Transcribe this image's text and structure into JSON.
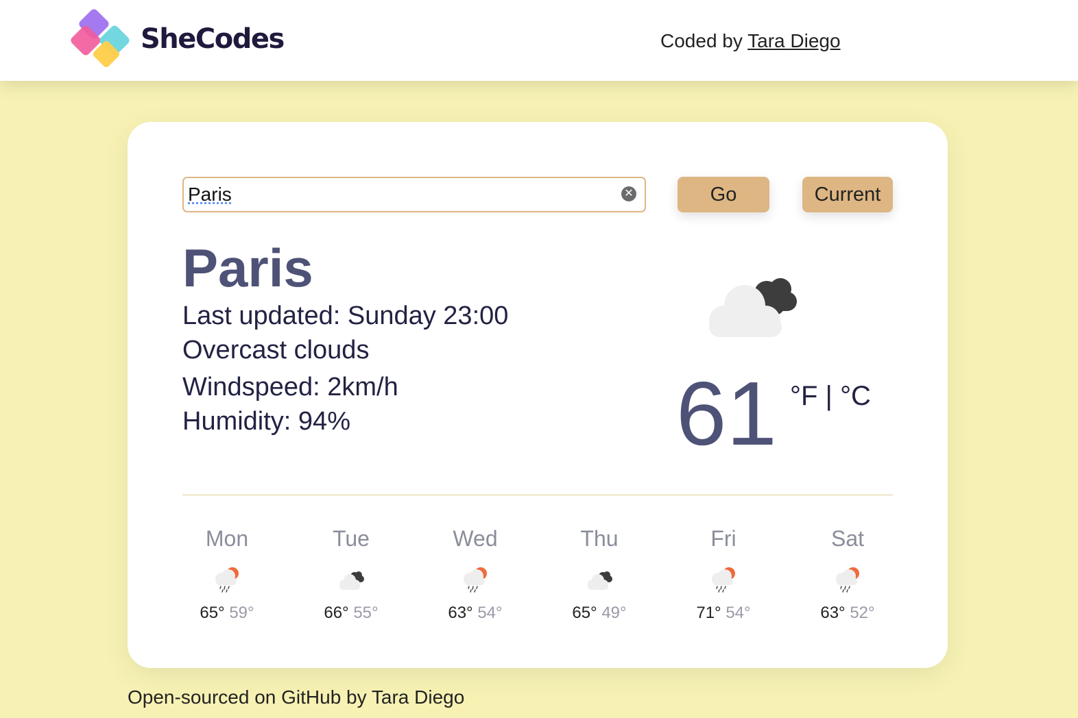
{
  "header": {
    "brand": "SheCodes",
    "coded_prefix": "Coded by ",
    "author_link": "Tara Diego"
  },
  "search": {
    "value": "Paris",
    "go_label": "Go",
    "current_label": "Current"
  },
  "weather": {
    "city": "Paris",
    "last_updated": "Last updated: Sunday 23:00",
    "description": "Overcast clouds",
    "windspeed": "Windspeed: 2km/h",
    "humidity": "Humidity: 94%",
    "temperature": "61",
    "unit_f": "°F",
    "unit_sep": " | ",
    "unit_c": "°C",
    "icon": "overcast-clouds-icon"
  },
  "forecast": [
    {
      "day": "Mon",
      "high": "65°",
      "low": "59°",
      "icon": "rain-sun-icon"
    },
    {
      "day": "Tue",
      "high": "66°",
      "low": "55°",
      "icon": "overcast-clouds-icon"
    },
    {
      "day": "Wed",
      "high": "63°",
      "low": "54°",
      "icon": "rain-sun-icon"
    },
    {
      "day": "Thu",
      "high": "65°",
      "low": "49°",
      "icon": "overcast-clouds-icon"
    },
    {
      "day": "Fri",
      "high": "71°",
      "low": "54°",
      "icon": "rain-sun-icon"
    },
    {
      "day": "Sat",
      "high": "63°",
      "low": "52°",
      "icon": "rain-sun-icon"
    }
  ],
  "footer": {
    "text": "Open-sourced on GitHub by Tara Diego"
  },
  "colors": {
    "background": "#f7f2b4",
    "button": "#ddb683",
    "accent_text": "#4f5277"
  }
}
